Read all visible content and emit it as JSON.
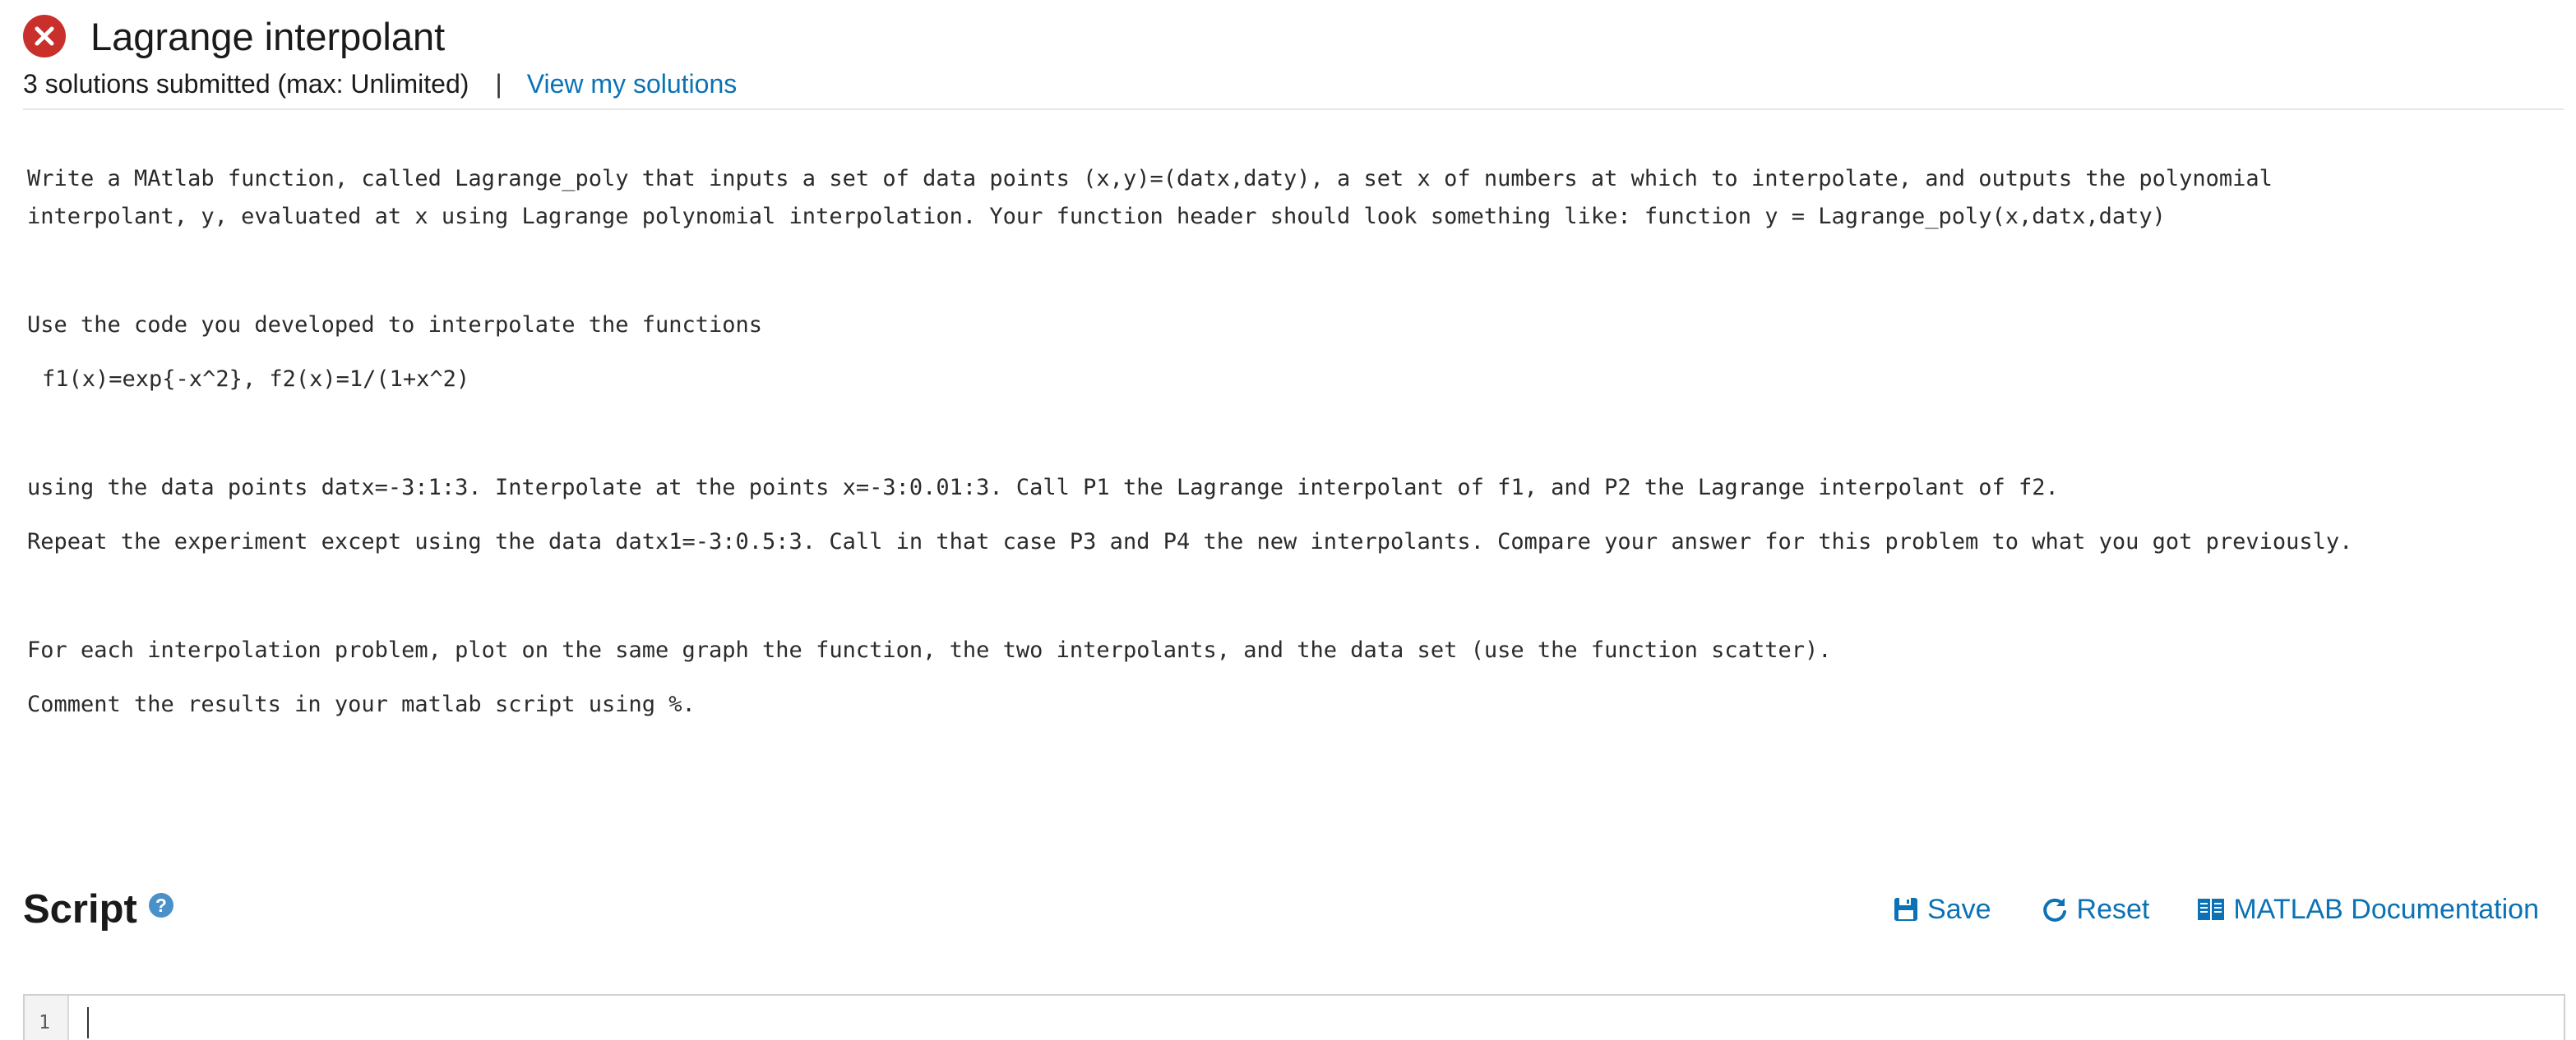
{
  "problem": {
    "title": "Lagrange interpolant",
    "status": "incorrect",
    "status_icon": "close-circle-icon",
    "status_color": "#c9302c",
    "submissions_text": "3 solutions submitted (max: Unlimited)",
    "separator": "|",
    "view_solutions_label": "View my solutions"
  },
  "description": {
    "paragraph1_line1": "Write a MAtlab function, called Lagrange_poly that inputs a set of data points (x,y)=(datx,daty), a set x of numbers at which to interpolate, and outputs the polynomial",
    "paragraph1_line2": "interpolant, y, evaluated at x using Lagrange polynomial interpolation. Your function header should look something like: function y = Lagrange_poly(x,datx,daty)",
    "paragraph2": "Use the code you developed to interpolate the functions",
    "paragraph3": "f1(x)=exp{-x^2}, f2(x)=1/(1+x^2)",
    "paragraph4": "using the data points datx=-3:1:3. Interpolate at the points x=-3:0.01:3. Call P1 the Lagrange interpolant of f1, and P2 the Lagrange interpolant of f2.",
    "paragraph5": "Repeat the experiment except using the data datx1=-3:0.5:3. Call in that case P3 and P4 the new interpolants. Compare your answer for this problem to what you got previously.",
    "paragraph6": "For each interpolation problem, plot on the same graph the function, the two interpolants, and the data set (use the function scatter).",
    "paragraph7": "Comment the results in your matlab script using %."
  },
  "script": {
    "heading": "Script",
    "help_icon": "question-circle-icon",
    "help_glyph": "?",
    "toolbar": {
      "save_label": "Save",
      "reset_label": "Reset",
      "docs_label": "MATLAB Documentation"
    },
    "editor": {
      "line_numbers": [
        "1"
      ],
      "content": ""
    }
  },
  "colors": {
    "link": "#0a72b5",
    "help_icon": "#4a90c9",
    "error": "#c9302c"
  }
}
